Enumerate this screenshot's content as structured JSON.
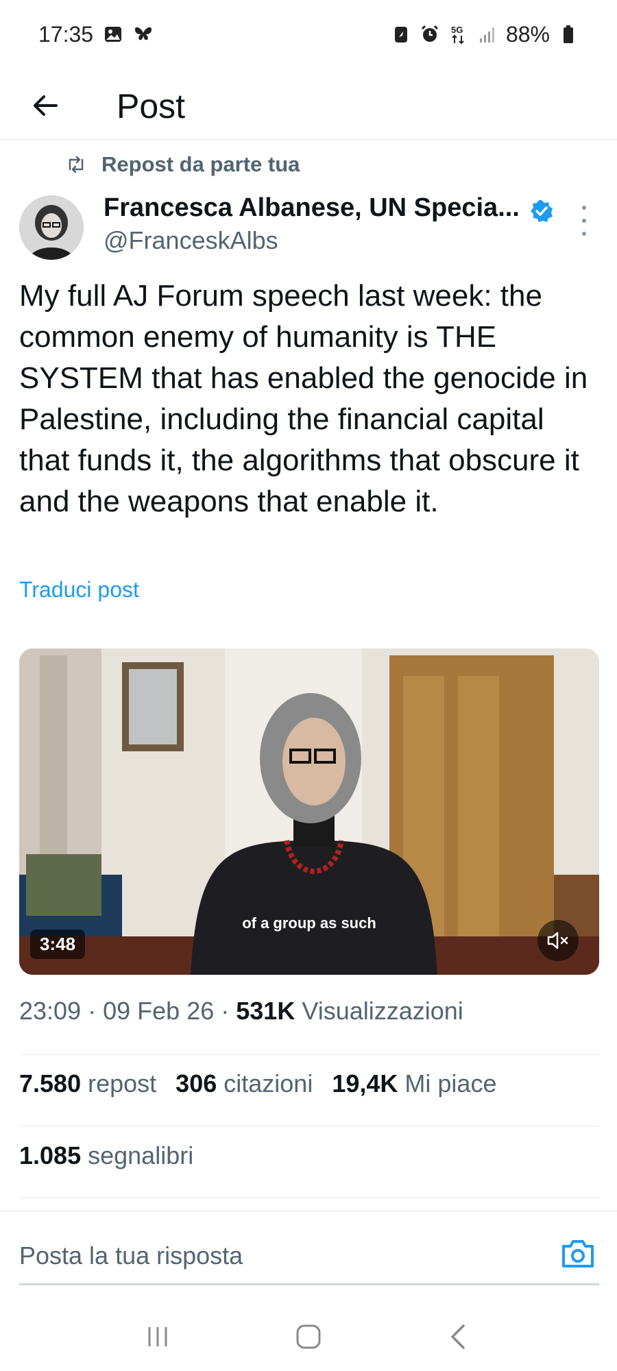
{
  "status_bar": {
    "time": "17:35",
    "left_icons": [
      "gallery-icon",
      "butterfly-icon"
    ],
    "right_icons": [
      "battery-saver-icon",
      "alarm-icon",
      "5g-icon",
      "signal-icon"
    ],
    "network": "5G",
    "battery": "88%"
  },
  "header": {
    "title": "Post",
    "back_icon": "arrow-left-icon"
  },
  "post": {
    "repost_label": "Repost da parte tua",
    "author_name": "Francesca Albanese, UN Specia...",
    "handle": "@FranceskAlbs",
    "verified": true,
    "text": "My full AJ Forum speech last week: the common enemy of humanity is THE SYSTEM that has enabled the genocide in Palestine, including the financial capital that funds it, the algorithms that obscure it and the weapons that enable it.",
    "translate_label": "Traduci post",
    "video": {
      "subtitle": "of a group as such",
      "duration": "3:48",
      "muted": true
    },
    "meta": {
      "time": "23:09",
      "date": "09 Feb 26",
      "views_count": "531K",
      "views_label": "Visualizzazioni"
    },
    "stats": {
      "reposts_count": "7.580",
      "reposts_label": "repost",
      "quotes_count": "306",
      "quotes_label": "citazioni",
      "likes_count": "19,4K",
      "likes_label": "Mi piace",
      "bookmarks_count": "1.085",
      "bookmarks_label": "segnalibri"
    }
  },
  "reply": {
    "placeholder": "Posta la tua risposta"
  },
  "colors": {
    "accent": "#1d9bf0",
    "text_primary": "#0f1419",
    "text_secondary": "#536471",
    "divider": "#e6e9ec"
  }
}
